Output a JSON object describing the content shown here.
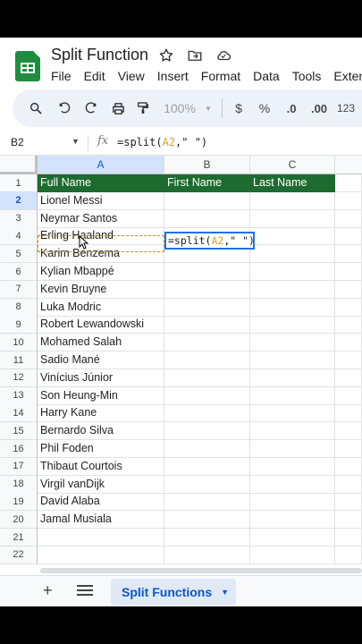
{
  "doc": {
    "title": "Split Function"
  },
  "menu": [
    "File",
    "Edit",
    "View",
    "Insert",
    "Format",
    "Data",
    "Tools",
    "Exten"
  ],
  "toolbar": {
    "zoom": "100%",
    "currency": "$",
    "percent": "%",
    "dec_decrease": ".0",
    "dec_increase": ".00",
    "number_format": "123"
  },
  "formula_bar": {
    "name_box": "B2",
    "fx": "fx",
    "prefix": "=split(",
    "ref": "A2",
    "suffix": ",\" \")"
  },
  "columns": [
    "A",
    "B",
    "C"
  ],
  "header_row": [
    "Full Name",
    "First Name",
    "Last Name"
  ],
  "rows": [
    "1",
    "2",
    "3",
    "4",
    "5",
    "6",
    "7",
    "8",
    "9",
    "10",
    "11",
    "12",
    "13",
    "14",
    "15",
    "16",
    "17",
    "18",
    "19",
    "20",
    "21",
    "22"
  ],
  "names": [
    "Lionel Messi",
    "Neymar Santos",
    "Erling Haaland",
    "Karim Benzema",
    "Kylian Mbappé",
    "Kevin Bruyne",
    "Luka Modric",
    "Robert Lewandowski",
    "Mohamed Salah",
    "Sadio Mané",
    "Vinícius Júnior",
    "Son Heung-Min",
    "Harry Kane",
    "Bernardo Silva",
    "Phil Foden",
    "Thibaut Courtois",
    "Virgil vanDijk",
    "David Alaba",
    "Jamal Musiala"
  ],
  "editing_cell": {
    "prefix": "=split(",
    "ref": "A2",
    "suffix": ",\" \")"
  },
  "sheet": {
    "add": "+",
    "active_tab": "Split Functions"
  },
  "colors": {
    "header_green": "#1e6b30",
    "accent_blue": "#1a73e8",
    "ref_color": "#d4a338"
  }
}
